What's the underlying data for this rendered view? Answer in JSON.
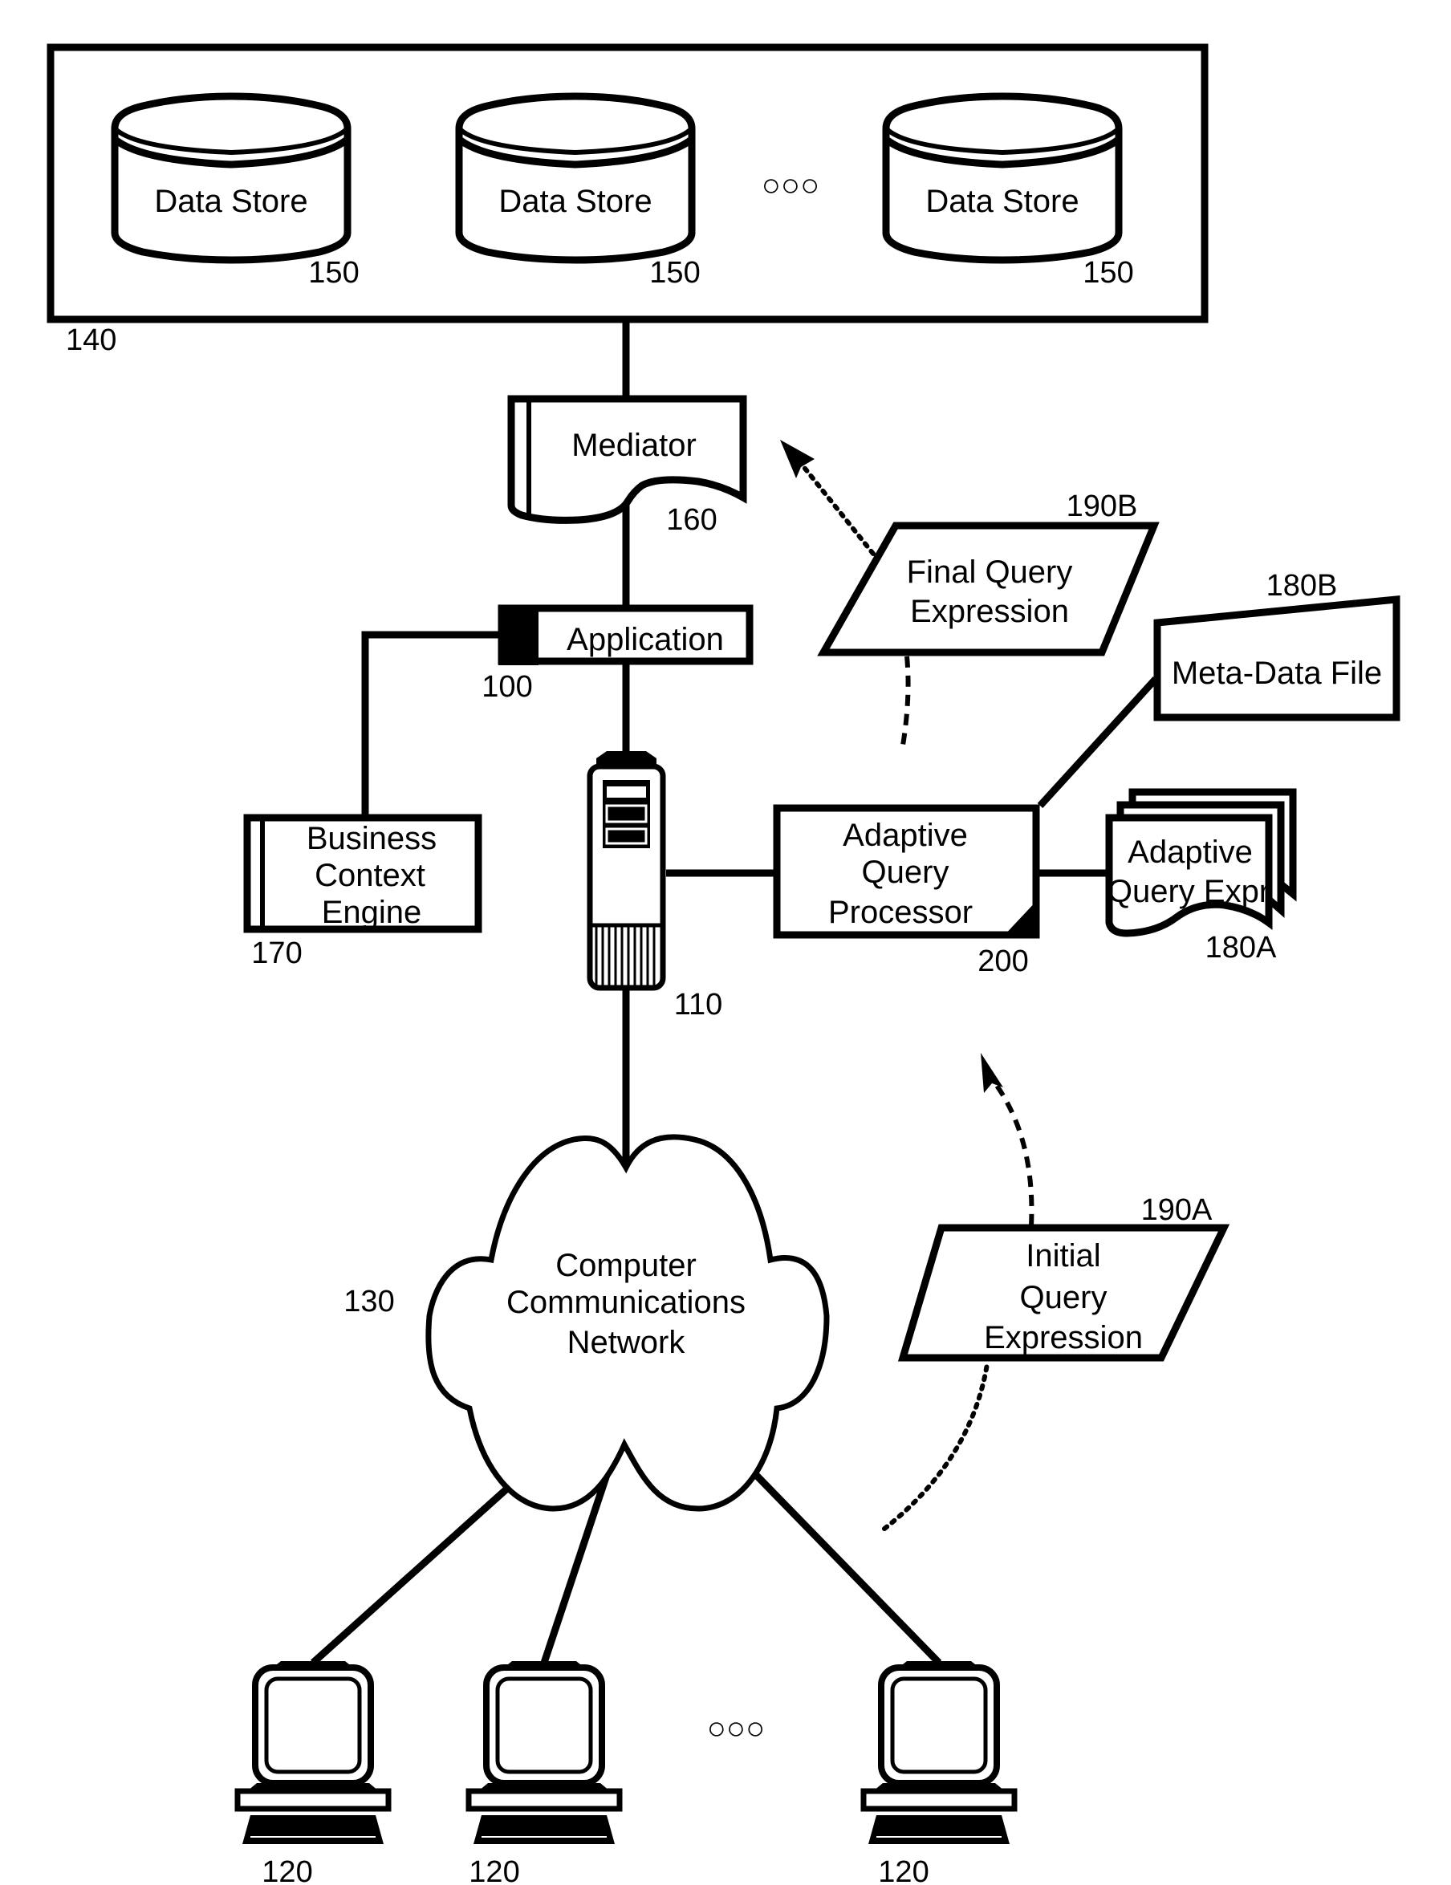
{
  "diagram": {
    "storage_group": {
      "ref": "140"
    },
    "data_stores": [
      {
        "label": "Data Store",
        "ref": "150"
      },
      {
        "label": "Data Store",
        "ref": "150"
      },
      {
        "label": "Data Store",
        "ref": "150"
      }
    ],
    "mediator": {
      "label": "Mediator",
      "ref": "160"
    },
    "application": {
      "label": "Application",
      "ref": "100"
    },
    "business_context_engine": {
      "lines": [
        "Business",
        "Context",
        "Engine"
      ],
      "ref": "170"
    },
    "server": {
      "ref": "110"
    },
    "adaptive_query_processor": {
      "lines": [
        "Adaptive",
        "Query",
        "Processor"
      ],
      "ref": "200"
    },
    "meta_data_file": {
      "label": "Meta-Data File",
      "ref": "180B"
    },
    "adaptive_query_expr": {
      "lines": [
        "Adaptive",
        "Query Expr"
      ],
      "ref": "180A"
    },
    "final_query_expression": {
      "lines": [
        "Final Query",
        "Expression"
      ],
      "ref": "190B"
    },
    "initial_query_expression": {
      "lines": [
        "Initial",
        "Query",
        "Expression"
      ],
      "ref": "190A"
    },
    "network": {
      "lines": [
        "Computer",
        "Communications",
        "Network"
      ],
      "ref": "130"
    },
    "clients": [
      {
        "ref": "120"
      },
      {
        "ref": "120"
      },
      {
        "ref": "120"
      }
    ],
    "ellipsis_glyph": "○○○"
  }
}
